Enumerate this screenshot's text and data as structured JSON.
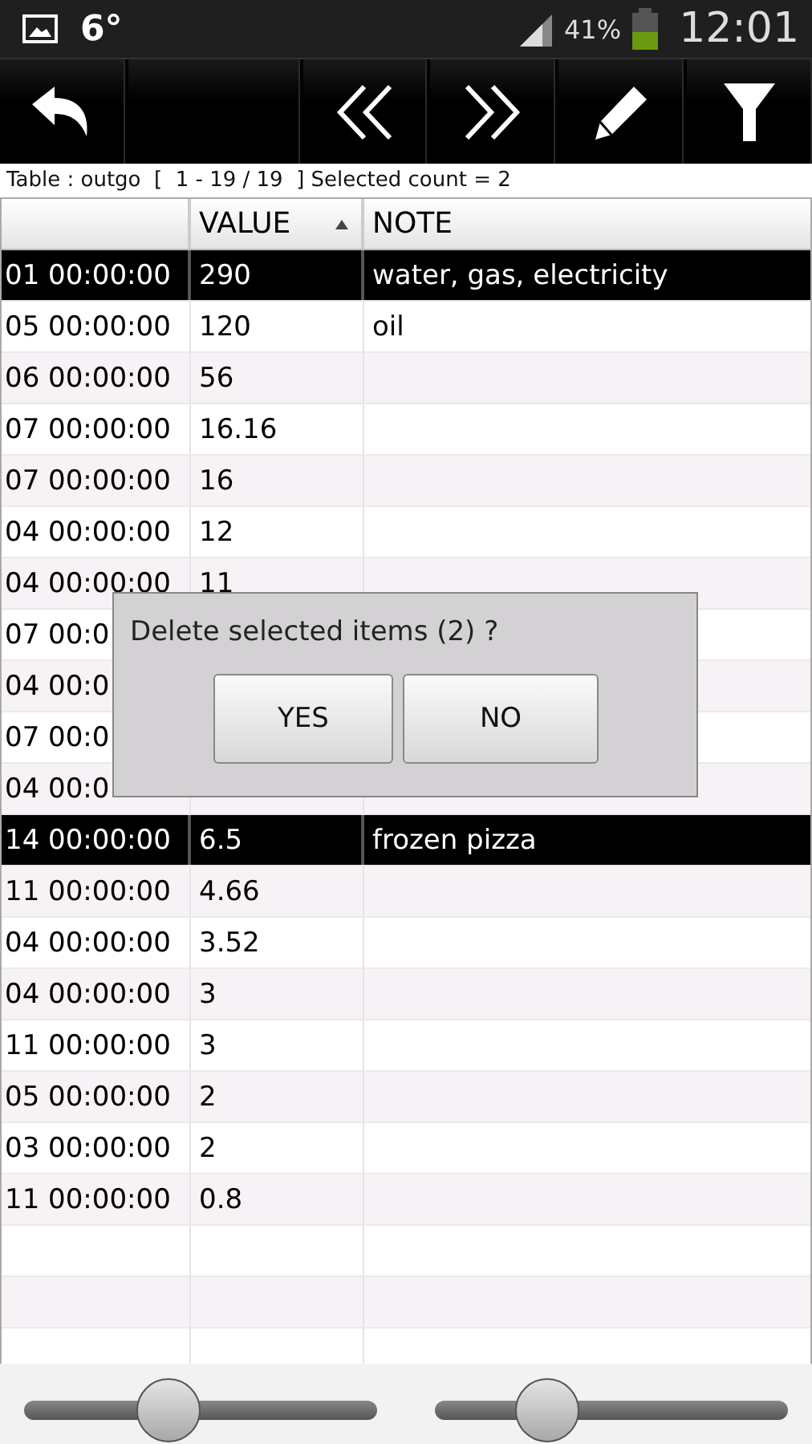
{
  "status_bar": {
    "temperature": "6°",
    "battery": "41%",
    "time": "12:01"
  },
  "toolbar": {
    "buttons": [
      {
        "kind": "back"
      },
      {
        "kind": "blank"
      },
      {
        "kind": "previous"
      },
      {
        "kind": "next"
      },
      {
        "kind": "edit"
      },
      {
        "kind": "filter"
      }
    ]
  },
  "info": "Table : outgo  [  1 - 19 / 19  ] Selected count = 2",
  "table": {
    "columns": [
      {
        "sorted": false
      },
      {
        "label": "VALUE",
        "sorted": true
      },
      {
        "label": "NOTE",
        "sorted": false
      }
    ],
    "rows": [
      {
        "cells": [
          "01 00:00:00",
          "290",
          "water, gas, electricity"
        ],
        "selected": true
      },
      {
        "cells": [
          "05 00:00:00",
          "120",
          "oil"
        ],
        "selected": false
      },
      {
        "cells": [
          "06 00:00:00",
          "56",
          ""
        ],
        "selected": false
      },
      {
        "cells": [
          "07 00:00:00",
          "16.16",
          ""
        ],
        "selected": false
      },
      {
        "cells": [
          "07 00:00:00",
          "16",
          ""
        ],
        "selected": false
      },
      {
        "cells": [
          "04 00:00:00",
          "12",
          ""
        ],
        "selected": false
      },
      {
        "cells": [
          "04 00:00:00",
          "11",
          ""
        ],
        "selected": false
      },
      {
        "cells": [
          "07 00:0",
          "",
          ""
        ],
        "selected": false
      },
      {
        "cells": [
          "04 00:0",
          "",
          ""
        ],
        "selected": false
      },
      {
        "cells": [
          "07 00:0",
          "",
          ""
        ],
        "selected": false
      },
      {
        "cells": [
          "04 00:0",
          "",
          ""
        ],
        "selected": false
      },
      {
        "cells": [
          "14 00:00:00",
          "6.5",
          "frozen pizza"
        ],
        "selected": true
      },
      {
        "cells": [
          "11 00:00:00",
          "4.66",
          ""
        ],
        "selected": false
      },
      {
        "cells": [
          "04 00:00:00",
          "3.52",
          ""
        ],
        "selected": false
      },
      {
        "cells": [
          "04 00:00:00",
          "3",
          ""
        ],
        "selected": false
      },
      {
        "cells": [
          "11 00:00:00",
          "3",
          ""
        ],
        "selected": false
      },
      {
        "cells": [
          "05 00:00:00",
          "2",
          ""
        ],
        "selected": false
      },
      {
        "cells": [
          "03 00:00:00",
          "2",
          ""
        ],
        "selected": false
      },
      {
        "cells": [
          "11 00:00:00",
          "0.8",
          ""
        ],
        "selected": false
      }
    ]
  },
  "dialog": {
    "message": "Delete selected items (2) ?",
    "buttons": [
      "YES",
      "NO"
    ]
  },
  "sliders": [
    {
      "level": 0.41
    },
    {
      "level": 0.32
    }
  ]
}
